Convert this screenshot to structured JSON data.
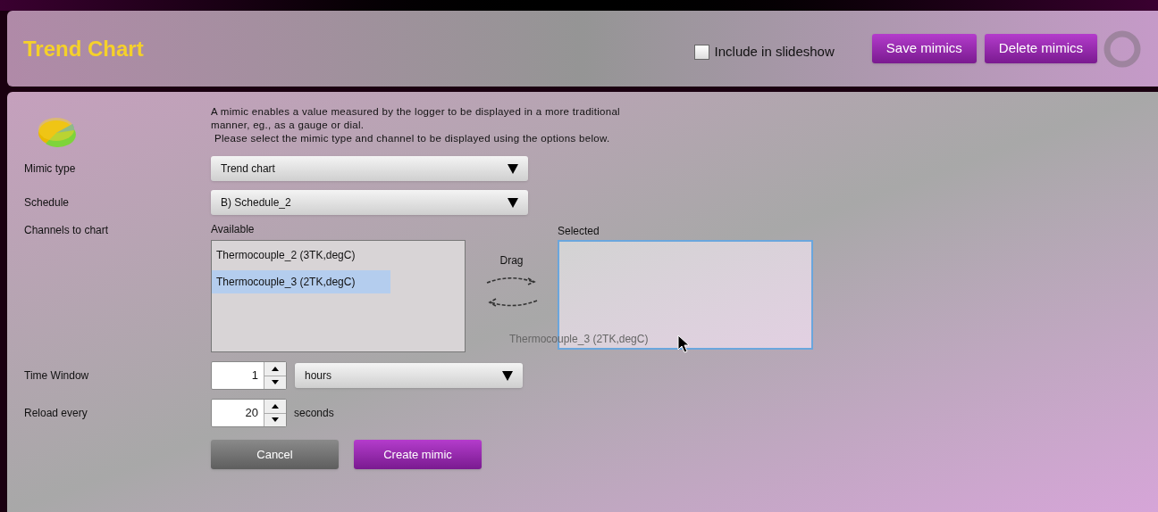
{
  "header": {
    "title": "Trend Chart",
    "include_in_slideshow": {
      "label": "Include in slideshow",
      "checked": false
    },
    "buttons": [
      "Save mimics",
      "Delete mimics"
    ]
  },
  "description": [
    "A mimic enables a value measured by the logger to be displayed in a more traditional",
    "manner, eg., as a gauge or dial.",
    "Please select the mimic type and channel to be displayed using the options below."
  ],
  "mimic_type": {
    "label": "Mimic type",
    "value": "Trend chart"
  },
  "schedule": {
    "label": "Schedule",
    "value": "B) Schedule_2"
  },
  "channels": {
    "label": "Channels to chart",
    "available_label": "Available",
    "available": [
      {
        "name": "Thermocouple_2 (3TK,degC)",
        "selected": false
      },
      {
        "name": "Thermocouple_3 (2TK,degC)",
        "selected": true
      }
    ],
    "drag_label": "Drag",
    "selected_label": "Selected",
    "dragged_item": "Thermocouple_3 (2TK,degC)"
  },
  "time_window": {
    "label": "Time Window",
    "value": "1",
    "unit": "hours"
  },
  "reload": {
    "label": "Reload every",
    "value": "20",
    "unit": "seconds"
  },
  "actions": [
    "Cancel",
    "Create mimic"
  ]
}
